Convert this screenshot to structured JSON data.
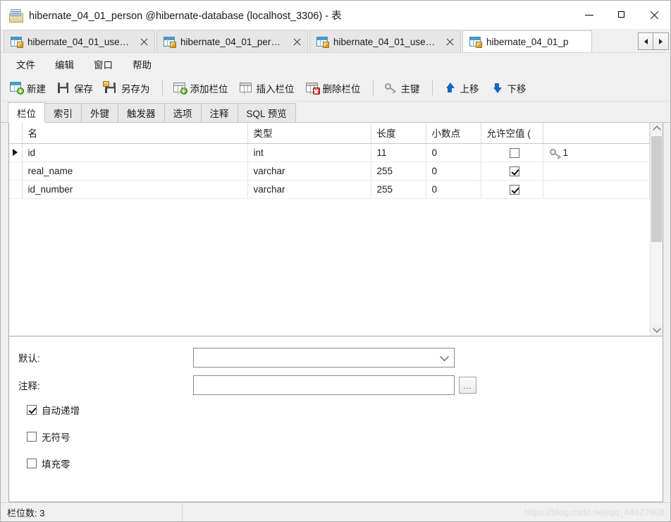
{
  "window": {
    "title": "hibernate_04_01_person @hibernate-database (localhost_3306) - 表",
    "icon": "table-window-icon",
    "controls": {
      "minimize": "minimize-icon",
      "maximize": "maximize-icon",
      "close": "close-icon"
    }
  },
  "tabs": {
    "items": [
      {
        "label": "hibernate_04_01_user ...",
        "icon": "table-editor-icon",
        "active": false,
        "closable": true
      },
      {
        "label": "hibernate_04_01_perso...",
        "icon": "table-editor-icon",
        "active": false,
        "closable": true
      },
      {
        "label": "hibernate_04_01_user ...",
        "icon": "table-editor-icon",
        "active": false,
        "closable": true
      },
      {
        "label": "hibernate_04_01_p",
        "icon": "table-editor-icon",
        "active": true,
        "closable": false
      }
    ],
    "nav": {
      "prev": "arrow-left-icon",
      "next": "arrow-right-icon"
    }
  },
  "menubar": {
    "items": [
      "文件",
      "编辑",
      "窗口",
      "帮助"
    ]
  },
  "toolbar": {
    "groups": [
      [
        {
          "label": "新建",
          "icon": "new-table-icon"
        },
        {
          "label": "保存",
          "icon": "save-icon"
        },
        {
          "label": "另存为",
          "icon": "save-as-icon"
        }
      ],
      [
        {
          "label": "添加栏位",
          "icon": "add-column-icon"
        },
        {
          "label": "插入栏位",
          "icon": "insert-column-icon"
        },
        {
          "label": "删除栏位",
          "icon": "delete-column-icon"
        }
      ],
      [
        {
          "label": "主键",
          "icon": "primary-key-icon"
        }
      ],
      [
        {
          "label": "上移",
          "icon": "arrow-up-icon"
        },
        {
          "label": "下移",
          "icon": "arrow-down-icon"
        }
      ]
    ]
  },
  "subtabs": {
    "items": [
      "栏位",
      "索引",
      "外键",
      "触发器",
      "选项",
      "注释",
      "SQL 预览"
    ],
    "active_index": 0
  },
  "grid": {
    "columns": [
      "名",
      "类型",
      "长度",
      "小数点",
      "允许空值 (",
      ""
    ],
    "rows": [
      {
        "selected": true,
        "name": "id",
        "type": "int",
        "length": "11",
        "decimals": "0",
        "nullable": false,
        "key": "1"
      },
      {
        "selected": false,
        "name": "real_name",
        "type": "varchar",
        "length": "255",
        "decimals": "0",
        "nullable": true,
        "key": ""
      },
      {
        "selected": false,
        "name": "id_number",
        "type": "varchar",
        "length": "255",
        "decimals": "0",
        "nullable": true,
        "key": ""
      }
    ],
    "scrollbar": {
      "up": "chevron-up-icon",
      "down": "chevron-down-icon"
    }
  },
  "form": {
    "default_label": "默认:",
    "default_value": "",
    "comment_label": "注释:",
    "comment_value": "",
    "browse_button": "...",
    "checkboxes": [
      {
        "label": "自动递增",
        "checked": true
      },
      {
        "label": "无符号",
        "checked": false
      },
      {
        "label": "填充零",
        "checked": false
      }
    ]
  },
  "statusbar": {
    "field_count": "栏位数: 3",
    "watermark": "https://blog.csdn.net/qq_44627608"
  }
}
